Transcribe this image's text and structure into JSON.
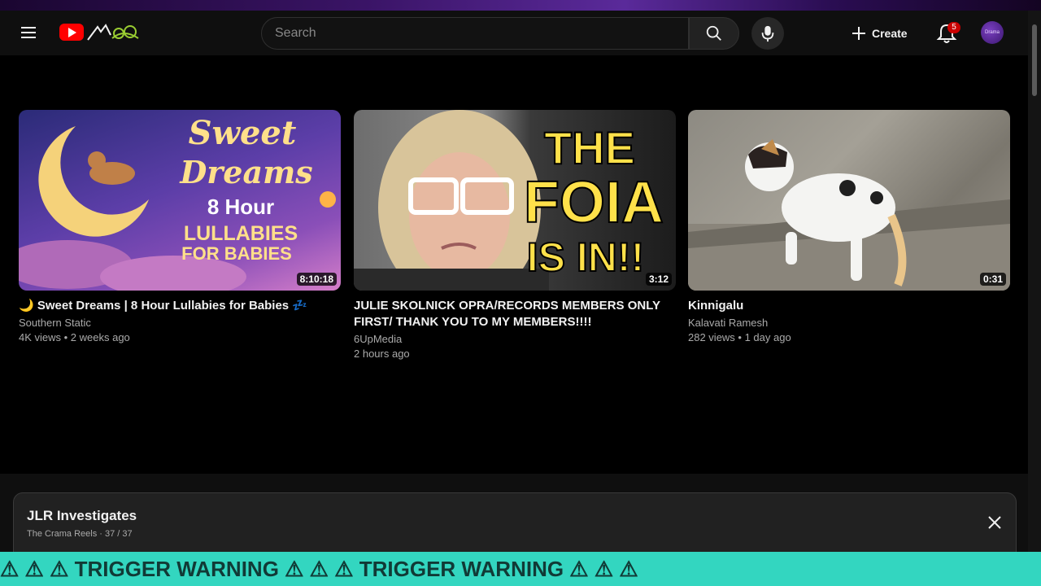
{
  "header": {
    "search_placeholder": "Search",
    "create_label": "Create",
    "notification_count": "5",
    "avatar_text": "Drama"
  },
  "videos": [
    {
      "title": "🌙 Sweet Dreams | 8 Hour Lullabies for Babies 💤",
      "channel": "Southern Static",
      "meta": "4K views • 2 weeks ago",
      "duration": "8:10:18",
      "thumb_text": [
        "Sweet",
        "Dreams",
        "8 Hour",
        "LULLABIES",
        "FOR BABIES"
      ]
    },
    {
      "title": "JULIE SKOLNICK OPRA/RECORDS MEMBERS ONLY FIRST/ THANK YOU TO MY MEMBERS!!!!",
      "channel": "6UpMedia",
      "meta": "2 hours ago",
      "duration": "3:12",
      "thumb_text": [
        "THE",
        "FOIA",
        "IS IN!!"
      ]
    },
    {
      "title": "Kinnigalu",
      "channel": "Kalavati Ramesh",
      "meta": "282 views • 1 day ago",
      "duration": "0:31"
    }
  ],
  "playlist": {
    "title": "JLR Investigates",
    "subtitle": "The Crama Reels · 37 / 37"
  },
  "ticker": {
    "text": "⚠ ⚠ ⚠ TRIGGER WARNING ⚠ ⚠ ⚠ TRIGGER WARNING ⚠ ⚠ ⚠"
  },
  "colors": {
    "accent": "#ff0000",
    "ticker_bg": "#33d6c0",
    "thumb_yellow": "#ffe14a"
  }
}
